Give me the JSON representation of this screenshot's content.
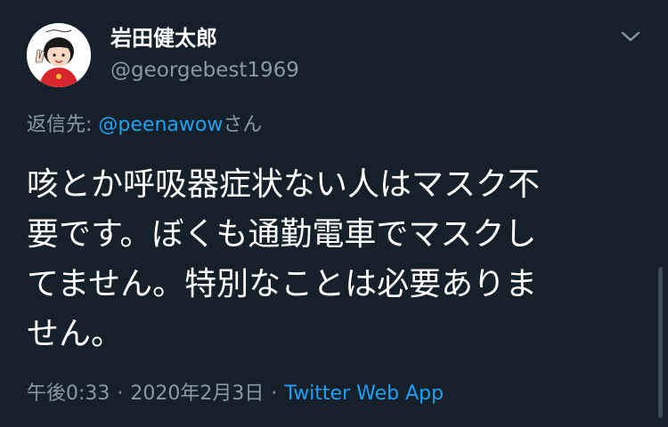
{
  "tweet": {
    "display_name": "岩田健太郎",
    "handle": "@georgebest1969",
    "reply_prefix": "返信先: ",
    "reply_mention": "@peenawow",
    "reply_suffix": "さん",
    "body_lines": [
      "咳とか呼吸器症状ない人はマスク不",
      "要です。ぼくも通勤電車でマスクし",
      "てません。特別なことは必要ありま",
      "せん。"
    ],
    "time": "午後0:33",
    "date": "2020年2月3日",
    "separator": "·",
    "source": "Twitter Web App"
  },
  "icons": {
    "caret": "chevron-down-icon",
    "avatar": "avatar-illustration"
  },
  "colors": {
    "background": "#15202b",
    "primary_text": "#ffffff",
    "secondary_text": "#8899a6",
    "link": "#1da1f2"
  }
}
